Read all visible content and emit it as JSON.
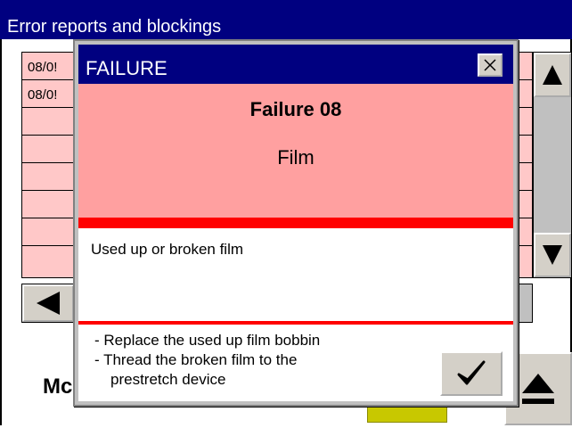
{
  "window": {
    "title": "Error reports and blockings",
    "bottom_label": "Mc"
  },
  "table": {
    "rows": [
      {
        "date": "08/0!"
      },
      {
        "date": "08/0!"
      },
      {
        "date": ""
      },
      {
        "date": ""
      },
      {
        "date": ""
      },
      {
        "date": ""
      },
      {
        "date": ""
      },
      {
        "date": ""
      }
    ]
  },
  "dialog": {
    "title": "FAILURE",
    "failure_code": "Failure 08",
    "failure_name": "Film",
    "description": "Used up or broken film",
    "actions": [
      "- Replace the used up film bobbin",
      "- Thread the broken film to the",
      "prestretch device"
    ]
  },
  "icons": {
    "close": "close-icon",
    "confirm": "checkmark-icon",
    "scroll_up": "arrow-up-icon",
    "scroll_down": "arrow-down-icon",
    "scroll_left": "arrow-left-icon",
    "eject": "eject-icon"
  },
  "colors": {
    "title_bar": "#000080",
    "table_row": "#ffc8c8",
    "dialog_header": "#ffa0a0",
    "accent_red": "#ff0000",
    "yellow_button": "#c8c800"
  }
}
